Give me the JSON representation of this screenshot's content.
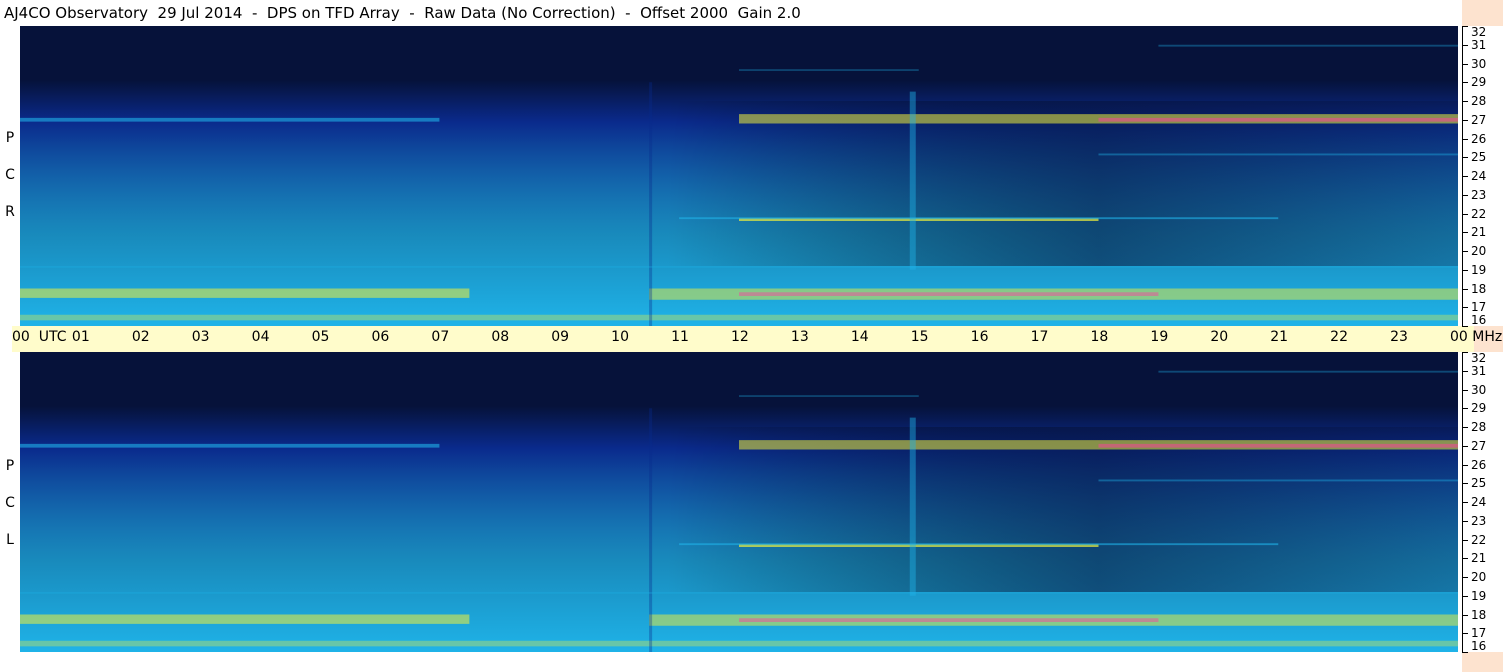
{
  "title": "AJ4CO Observatory  29 Jul 2014  -  DPS on TFD Array  -  Raw Data (No Correction)  -  Offset 2000  Gain 2.0",
  "chart_data": {
    "type": "heatmap",
    "title": "AJ4CO Observatory  29 Jul 2014  -  DPS on TFD Array  -  Raw Data (No Correction)  -  Offset 2000  Gain 2.0",
    "x_axis": {
      "ticks": [
        "00",
        "01",
        "02",
        "03",
        "04",
        "05",
        "06",
        "07",
        "08",
        "09",
        "10",
        "11",
        "12",
        "13",
        "14",
        "15",
        "16",
        "17",
        "18",
        "19",
        "20",
        "21",
        "22",
        "23",
        "00"
      ],
      "unit_left": "UTC",
      "unit_right": "MHz",
      "range": [
        0,
        24
      ]
    },
    "y_axis": {
      "ticks": [
        32,
        31,
        30,
        29,
        28,
        27,
        26,
        25,
        24,
        23,
        22,
        21,
        20,
        19,
        18,
        17,
        16
      ],
      "range": [
        16,
        32
      ]
    },
    "panels": [
      {
        "name": "rcp",
        "label": [
          "R",
          "C",
          "P"
        ]
      },
      {
        "name": "lcp",
        "label": [
          "L",
          "C",
          "P"
        ]
      }
    ],
    "colors": {
      "background": "#06123a",
      "low": "#0a2a8c",
      "mid": "#1fb3e8",
      "high": "#f0f03a",
      "peak": "#ff3ca0"
    }
  }
}
